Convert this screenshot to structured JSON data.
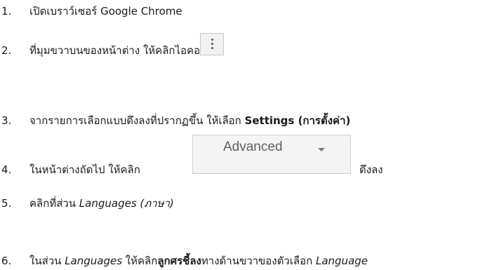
{
  "steps": [
    {
      "number": "1.",
      "text": "เปิดเบราว์เซอร์ Google Chrome"
    },
    {
      "number": "2.",
      "text": "ที่มุมขวาบนของหน้าต่าง ให้คลิกไอคอน"
    },
    {
      "number": "3.",
      "text_before": "จากรายการเลือกแบบดึงลงที่ปรากฏขึ้น ให้เลือก ",
      "bold": "Settings (การตั้งค่า)"
    },
    {
      "number": "4.",
      "text_before": "ในหน้าต่างถัดไป ให้คลิก",
      "button_label": "Advanced",
      "text_after": "ดึงลง"
    },
    {
      "number": "5.",
      "text_before": "คลิกที่ส่วน ",
      "italic": "Languages (ภาษา)"
    },
    {
      "number": "6.",
      "text_before": "ในส่วน ",
      "italic1": "Languages",
      "text_mid": " ให้คลิก",
      "bold": "ลูกศรชี้ลง",
      "text_after": "ทางด้านขวาของตัวเลือก ",
      "italic2": "Language"
    }
  ]
}
